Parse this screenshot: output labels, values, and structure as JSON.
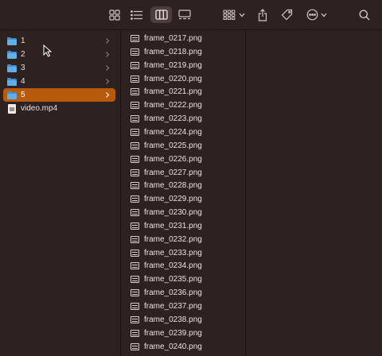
{
  "toolbar": {
    "icons": [
      "icon-view-grid-icon",
      "list-view-icon",
      "column-view-icon",
      "gallery-view-icon",
      "group-icon",
      "chevron-down-icon",
      "share-icon",
      "tag-icon",
      "more-icon",
      "search-icon"
    ]
  },
  "sidebar": {
    "items": [
      {
        "label": "1",
        "type": "folder"
      },
      {
        "label": "2",
        "type": "folder"
      },
      {
        "label": "3",
        "type": "folder"
      },
      {
        "label": "4",
        "type": "folder"
      },
      {
        "label": "5",
        "type": "folder",
        "selected": true
      },
      {
        "label": "video.mp4",
        "type": "file"
      }
    ]
  },
  "files": {
    "items": [
      "frame_0217.png",
      "frame_0218.png",
      "frame_0219.png",
      "frame_0220.png",
      "frame_0221.png",
      "frame_0222.png",
      "frame_0223.png",
      "frame_0224.png",
      "frame_0225.png",
      "frame_0226.png",
      "frame_0227.png",
      "frame_0228.png",
      "frame_0229.png",
      "frame_0230.png",
      "frame_0231.png",
      "frame_0232.png",
      "frame_0233.png",
      "frame_0234.png",
      "frame_0235.png",
      "frame_0236.png",
      "frame_0237.png",
      "frame_0238.png",
      "frame_0239.png",
      "frame_0240.png"
    ]
  },
  "colors": {
    "selection": "#b85a0c",
    "folder": "#62aee6",
    "background": "#2e2221"
  }
}
